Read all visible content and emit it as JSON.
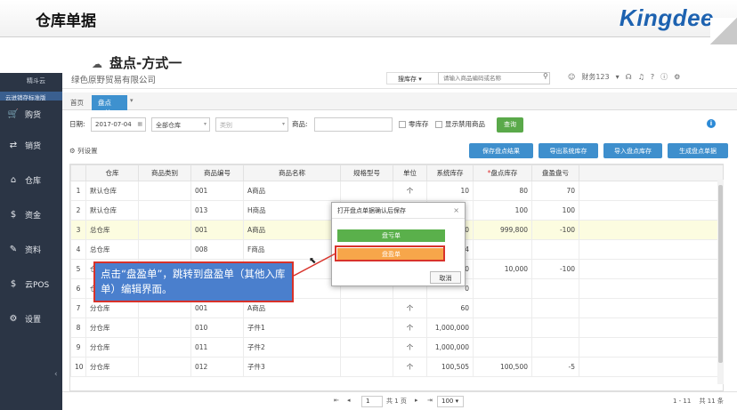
{
  "slide": {
    "title": "仓库单据",
    "subtitle": "盘点-方式一",
    "brand": "Kingdee"
  },
  "sidebar": {
    "logo": "精斗云",
    "sub": "云进销存标准版",
    "items": [
      {
        "label": "购货",
        "icon": "cart-icon"
      },
      {
        "label": "销货",
        "icon": "sales-icon"
      },
      {
        "label": "仓库",
        "icon": "warehouse-icon"
      },
      {
        "label": "资金",
        "icon": "money-icon"
      },
      {
        "label": "资料",
        "icon": "edit-icon"
      },
      {
        "label": "云POS",
        "icon": "pos-icon"
      },
      {
        "label": "设置",
        "icon": "gear-icon"
      }
    ]
  },
  "topbar": {
    "company": "绿色原野贸易有限公司",
    "scope": "搜库存",
    "search_placeholder": "请输入商品编码或名称",
    "user": "财务123"
  },
  "tabs": {
    "home": "首页",
    "active": "盘点"
  },
  "filters": {
    "date_label": "日期:",
    "date": "2017-07-04",
    "warehouse": "全部仓库",
    "category_placeholder": "类别",
    "goods_label": "商品:",
    "zero_stock": "零库存",
    "show_disabled": "显示禁用商品",
    "query": "查询"
  },
  "actions": {
    "colset": "列设置",
    "save_result": "保存盘点结果",
    "export": "导出系统库存",
    "import": "导入盘点库存",
    "generate": "生成盘点单据"
  },
  "table": {
    "headers": [
      "",
      "仓库",
      "商品类别",
      "商品编号",
      "商品名称",
      "规格型号",
      "单位",
      "系统库存",
      "盘点库存",
      "盘盈盘亏"
    ],
    "required_mark": "*",
    "rows": [
      [
        "1",
        "默认仓库",
        "",
        "001",
        "A商品",
        "",
        "个",
        "10",
        "80",
        "70"
      ],
      [
        "2",
        "默认仓库",
        "",
        "013",
        "H商品",
        "",
        "",
        "",
        "100",
        "100"
      ],
      [
        "3",
        "总仓库",
        "",
        "001",
        "A商品",
        "",
        "",
        "00",
        "999,800",
        "-100"
      ],
      [
        "4",
        "总仓库",
        "",
        "008",
        "F商品",
        "",
        "",
        "24",
        "",
        ""
      ],
      [
        "5",
        "仓",
        "",
        "",
        "",
        "",
        "",
        "00",
        "10,000",
        "-100"
      ],
      [
        "6",
        "仓",
        "",
        "",
        "",
        "",
        "",
        "0",
        "",
        ""
      ],
      [
        "7",
        "分仓库",
        "",
        "001",
        "A商品",
        "",
        "个",
        "60",
        "",
        ""
      ],
      [
        "8",
        "分仓库",
        "",
        "010",
        "子件1",
        "",
        "个",
        "1,000,000",
        "",
        ""
      ],
      [
        "9",
        "分仓库",
        "",
        "011",
        "子件2",
        "",
        "个",
        "1,000,000",
        "",
        ""
      ],
      [
        "10",
        "分仓库",
        "",
        "012",
        "子件3",
        "",
        "个",
        "100,505",
        "100,500",
        "-5"
      ]
    ]
  },
  "footer": {
    "page": "1",
    "total_pages": "共 1 页",
    "page_size": "100",
    "summary": "1 - 11 　共 11 条"
  },
  "dialog": {
    "title": "打开盘点单据确认后保存",
    "profit_btn": "盘亏单",
    "loss_btn": "盘盈单",
    "cancel": "取消"
  },
  "callout": {
    "text": "点击“盘盈单”，跳转到盘盈单（其他入库单）编辑界面。"
  },
  "colors": {
    "accent": "#3e8fcd",
    "sidebar": "#2b3545",
    "green": "#5aa94a",
    "orange": "#f7a64a",
    "highlight": "#d8322a"
  }
}
